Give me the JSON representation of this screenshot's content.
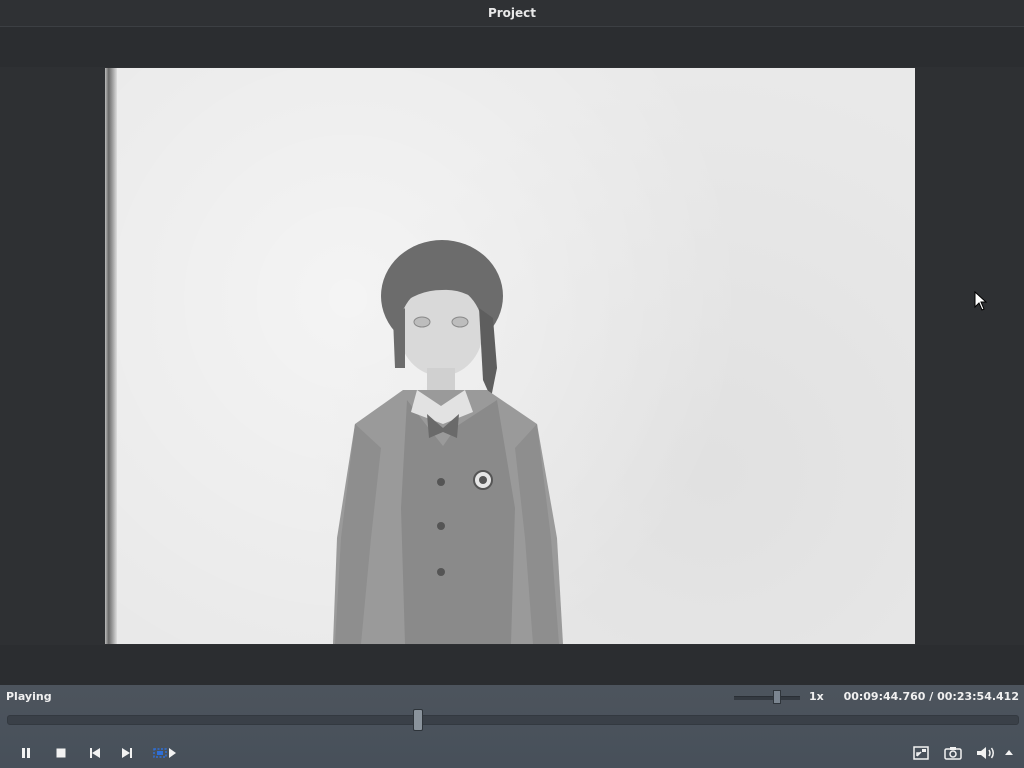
{
  "window": {
    "title": "Project"
  },
  "status": {
    "state": "Playing"
  },
  "playback": {
    "speed_label": "1x",
    "speed_level": 0.65,
    "current_time": "00:09:44.760",
    "separator": " / ",
    "total_time": "00:23:54.412",
    "progress": 0.407
  },
  "controls": {
    "left": [
      {
        "icon": "pause-icon"
      },
      {
        "icon": "stop-icon"
      },
      {
        "icon": "previous-icon"
      },
      {
        "icon": "next-icon"
      },
      {
        "icon": "frame-step-icon"
      }
    ],
    "right": [
      {
        "icon": "fullscreen-icon"
      },
      {
        "icon": "camera-icon"
      },
      {
        "icon": "volume-icon"
      },
      {
        "icon": "dropdown-arrow-icon"
      }
    ]
  },
  "colors": {
    "accent_blue": "#2f6fd6",
    "text": "#f0f0f0"
  }
}
